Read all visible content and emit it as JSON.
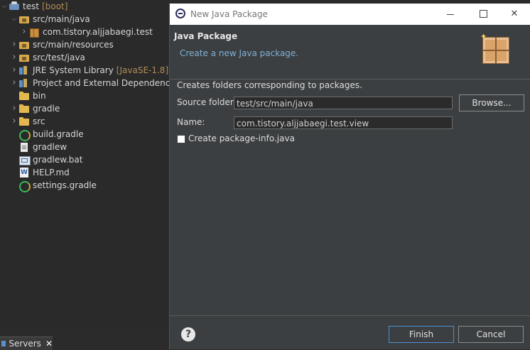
{
  "explorer": {
    "items": [
      {
        "label": "test",
        "decoration": "[boot]",
        "icon": "project-icon",
        "twisty": "down",
        "indent": 0
      },
      {
        "label": "src/main/java",
        "decoration": "",
        "icon": "package-folder-icon",
        "twisty": "down",
        "indent": 1
      },
      {
        "label": "com.tistory.aljjabaegi.test",
        "decoration": "",
        "icon": "package-icon",
        "twisty": "right",
        "indent": 2
      },
      {
        "label": "src/main/resources",
        "decoration": "",
        "icon": "package-folder-icon",
        "twisty": "right",
        "indent": 1
      },
      {
        "label": "src/test/java",
        "decoration": "",
        "icon": "package-folder-icon",
        "twisty": "right",
        "indent": 1
      },
      {
        "label": "JRE System Library",
        "decoration": "[JavaSE-1.8]",
        "icon": "library-icon",
        "twisty": "right",
        "indent": 1
      },
      {
        "label": "Project and External Dependencies",
        "decoration": "",
        "icon": "library-icon",
        "twisty": "right",
        "indent": 1
      },
      {
        "label": "bin",
        "decoration": "",
        "icon": "folder-icon",
        "twisty": "",
        "indent": 1
      },
      {
        "label": "gradle",
        "decoration": "",
        "icon": "folder-icon",
        "twisty": "right",
        "indent": 1
      },
      {
        "label": "src",
        "decoration": "",
        "icon": "folder-icon",
        "twisty": "right",
        "indent": 1
      },
      {
        "label": "build.gradle",
        "decoration": "",
        "icon": "gradle-icon",
        "twisty": "",
        "indent": 1
      },
      {
        "label": "gradlew",
        "decoration": "",
        "icon": "file-icon",
        "twisty": "",
        "indent": 1
      },
      {
        "label": "gradlew.bat",
        "decoration": "",
        "icon": "bat-file-icon",
        "twisty": "",
        "indent": 1
      },
      {
        "label": "HELP.md",
        "decoration": "",
        "icon": "markdown-file-icon",
        "twisty": "",
        "indent": 1
      },
      {
        "label": "settings.gradle",
        "decoration": "",
        "icon": "gradle-icon",
        "twisty": "",
        "indent": 1
      }
    ]
  },
  "servers_tab": {
    "label": "Servers"
  },
  "dialog": {
    "window_title": "New Java Package",
    "header_title": "Java Package",
    "header_description": "Create a new Java package.",
    "intro": "Creates folders corresponding to packages.",
    "source_folder_label": "Source folder:",
    "source_folder_value": "test/src/main/java",
    "browse_label": "Browse...",
    "name_label": "Name:",
    "name_value": "com.tistory.aljjabaegi.test.view",
    "create_info_label": "Create package-info.java",
    "create_info_checked": false,
    "finish_label": "Finish",
    "cancel_label": "Cancel",
    "help_symbol": "?"
  },
  "colors": {
    "dialog_bg": "#3c3f41",
    "link_text": "#7fb0d6",
    "decoration_text": "#b08c56",
    "default_button_border": "#4a8fd0"
  }
}
